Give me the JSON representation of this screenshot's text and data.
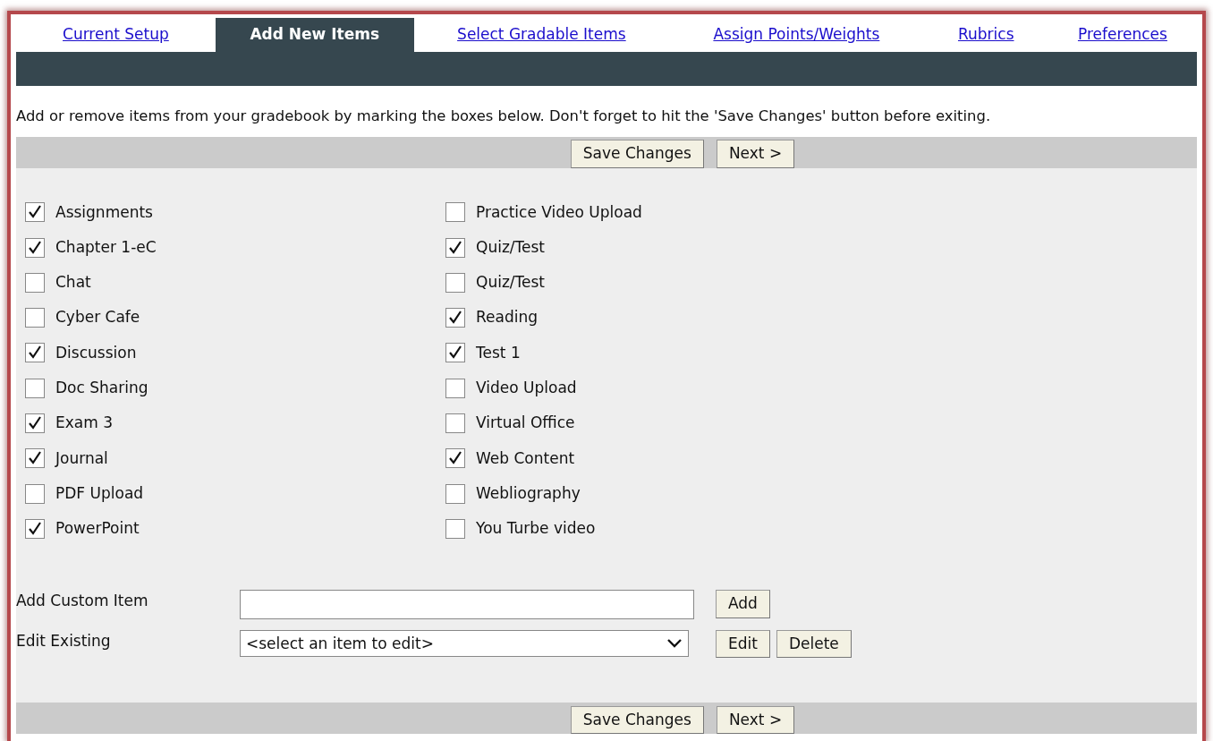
{
  "tabs": [
    {
      "label": "Current Setup",
      "selected": false
    },
    {
      "label": "Add New Items",
      "selected": true
    },
    {
      "label": "Select Gradable Items",
      "selected": false
    },
    {
      "label": "Assign Points/Weights",
      "selected": false
    },
    {
      "label": "Rubrics",
      "selected": false
    },
    {
      "label": "Preferences",
      "selected": false
    }
  ],
  "instructions": "Add or remove items from your gradebook by marking the boxes below. Don't forget to hit the 'Save Changes' button before exiting.",
  "top_toolbar": {
    "buttons": [
      "Save Changes",
      "Next >"
    ]
  },
  "checklist": {
    "columns": [
      {
        "items": [
          {
            "label": "Assignments",
            "checked": true
          },
          {
            "label": "Chapter 1-eC",
            "checked": true
          },
          {
            "label": "Chat",
            "checked": false
          },
          {
            "label": "Cyber Cafe",
            "checked": false
          },
          {
            "label": "Discussion",
            "checked": true
          },
          {
            "label": "Doc Sharing",
            "checked": false
          },
          {
            "label": "Exam 3",
            "checked": true
          },
          {
            "label": "Journal",
            "checked": true
          },
          {
            "label": "PDF Upload",
            "checked": false
          },
          {
            "label": "PowerPoint",
            "checked": true
          }
        ]
      },
      {
        "items": [
          {
            "label": "Practice Video Upload",
            "checked": false
          },
          {
            "label": "Quiz/Test",
            "checked": true
          },
          {
            "label": "Quiz/Test",
            "checked": false
          },
          {
            "label": "Reading",
            "checked": true
          },
          {
            "label": "Test 1",
            "checked": true
          },
          {
            "label": "Video Upload",
            "checked": false
          },
          {
            "label": "Virtual Office",
            "checked": false
          },
          {
            "label": "Web Content",
            "checked": true
          },
          {
            "label": "Webliography",
            "checked": false
          },
          {
            "label": "You Turbe video",
            "checked": false
          }
        ]
      }
    ]
  },
  "custom_item": {
    "label": "Add Custom Item",
    "button": "Add"
  },
  "edit_existing": {
    "label": "Edit Existing",
    "value": "<select an item to edit>",
    "buttons": [
      "Edit",
      "Delete"
    ]
  },
  "bottom_toolbar": {
    "buttons": [
      "Save Changes",
      "Next >"
    ]
  }
}
